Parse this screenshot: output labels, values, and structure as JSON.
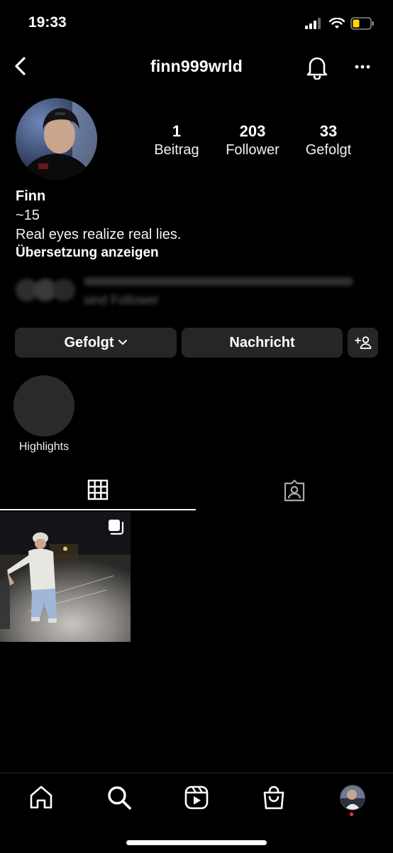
{
  "status_bar": {
    "time": "19:33"
  },
  "header": {
    "username": "finn999wrld"
  },
  "stats": [
    {
      "value": "1",
      "label": "Beitrag"
    },
    {
      "value": "203",
      "label": "Follower"
    },
    {
      "value": "33",
      "label": "Gefolgt"
    }
  ],
  "bio": {
    "name": "Finn",
    "line1": "~15",
    "line2": "Real eyes realize real lies.",
    "translate": "Übersetzung anzeigen"
  },
  "followed_by": "sind Follower",
  "actions": {
    "following": "Gefolgt",
    "message": "Nachricht"
  },
  "highlights": {
    "label": "Highlights"
  },
  "colors": {
    "background": "#000000",
    "button": "#262626",
    "notification_dot": "#ff3040",
    "battery": "#ffd60a"
  }
}
